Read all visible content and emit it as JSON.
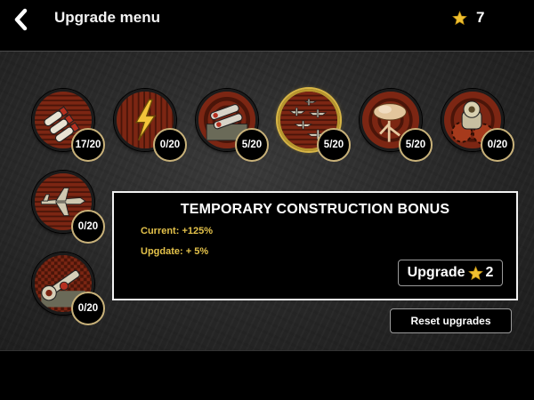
{
  "header": {
    "title": "Upgrade menu",
    "stars": "7"
  },
  "upgrades": [
    {
      "icon": "ammo-shells-icon",
      "count": "17/20"
    },
    {
      "icon": "lightning-icon",
      "count": "0/20"
    },
    {
      "icon": "rocket-launcher-icon",
      "count": "5/20"
    },
    {
      "icon": "aircraft-squadron-icon",
      "count": "5/20",
      "selected": true
    },
    {
      "icon": "explosion-cloud-icon",
      "count": "5/20"
    },
    {
      "icon": "gear-turret-icon",
      "count": "0/20"
    },
    {
      "icon": "fighter-plane-icon",
      "count": "0/20"
    },
    {
      "icon": "wrench-construction-icon",
      "count": "0/20"
    }
  ],
  "info": {
    "title": "TEMPORARY CONSTRUCTION BONUS",
    "current": "Current: +125%",
    "upgrade": "Upgdate: + 5%"
  },
  "buttons": {
    "upgrade_label": "Upgrade",
    "upgrade_cost": "2",
    "reset_label": "Reset upgrades"
  },
  "colors": {
    "accent_gold": "#e4c24a",
    "star": "#f0c030",
    "disc_red": "#7a2412"
  }
}
